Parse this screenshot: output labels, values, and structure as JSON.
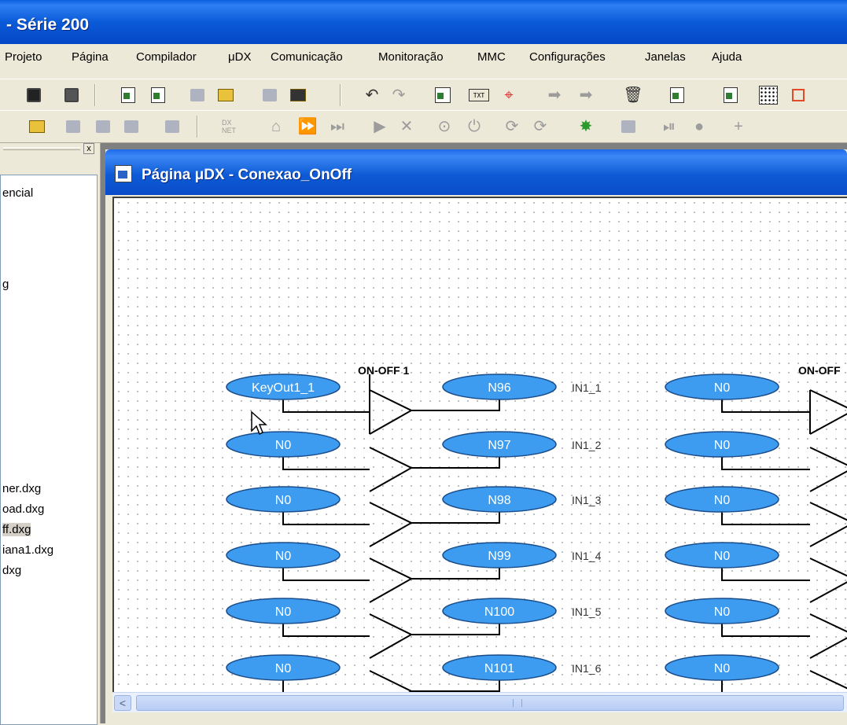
{
  "window": {
    "title": "- Série 200"
  },
  "menu": [
    "Projeto",
    "Página",
    "Compilador",
    "μDX",
    "Comunicação",
    "Monitoração",
    "MMC",
    "Configurações",
    "Janelas",
    "Ajuda"
  ],
  "toolbar1": {
    "icons": [
      "save-icon",
      "save-all-icon",
      "export-icon",
      "import-icon",
      "compile-icon",
      "folder-compile-icon",
      "page-icon",
      "page-yellow-icon",
      "undo-icon",
      "redo-icon",
      "copy-icon",
      "txt-icon",
      "watch-icon",
      "arrow-right-icon",
      "arrow-right-2-icon",
      "trash-icon",
      "properties-icon",
      "properties-2-icon",
      "grid-icon",
      "border-icon"
    ],
    "txt_label": "TXT"
  },
  "toolbar2": {
    "icons": [
      "open-folder-icon",
      "send-icon",
      "receive-icon",
      "receive-all-icon",
      "network-icon",
      "dxnet-icon",
      "home-icon",
      "fast-forward-icon",
      "step-icon",
      "play-icon",
      "stop-icon",
      "help-icon",
      "power-icon",
      "refresh-icon",
      "refresh-2-icon",
      "star-icon",
      "module-icon",
      "pause-icon",
      "record-icon",
      "add-icon"
    ],
    "dxnet_label": "DX NET"
  },
  "left_panel": {
    "files": [
      {
        "label": "encial",
        "selected": false
      },
      {
        "label": "g",
        "selected": false
      },
      {
        "label": "ner.dxg",
        "selected": false
      },
      {
        "label": "oad.dxg",
        "selected": false
      },
      {
        "label": "ff.dxg",
        "selected": true
      },
      {
        "label": "iana1.dxg",
        "selected": false
      },
      {
        "label": "dxg",
        "selected": false
      }
    ],
    "close_label": "x"
  },
  "child_window": {
    "title": "Página μDX - Conexao_OnOff"
  },
  "diagram": {
    "blocks": [
      {
        "title": "ON-OFF 1"
      },
      {
        "title": "ON-OFF"
      }
    ],
    "left_inputs": [
      "KeyOut1_1",
      "N0",
      "N0",
      "N0",
      "N0",
      "N0"
    ],
    "right_nodes": [
      "N96",
      "N97",
      "N98",
      "N99",
      "N100",
      "N101"
    ],
    "pin_labels": [
      "IN1_1",
      "IN1_2",
      "IN1_3",
      "IN1_4",
      "IN1_5",
      "IN1_6"
    ],
    "far_inputs": [
      "N0",
      "N0",
      "N0",
      "N0",
      "N0",
      "N0"
    ],
    "node_color": "#3d9cf0"
  },
  "scrollbar": {
    "left_arrow": "<"
  }
}
